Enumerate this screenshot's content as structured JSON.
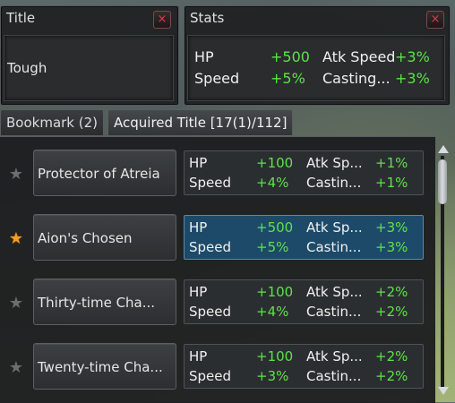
{
  "title_panel": {
    "header": "Title",
    "current": "Tough",
    "close": "×"
  },
  "stats_panel": {
    "header": "Stats",
    "close": "×",
    "lines": [
      {
        "a": "HP",
        "av": "+500",
        "b": "Atk Speed",
        "bv": "+3%"
      },
      {
        "a": "Speed",
        "av": "+5%",
        "b": "Casting...",
        "bv": "+3%"
      }
    ]
  },
  "tabs": [
    {
      "label": "Bookmark (2)"
    },
    {
      "label": "Acquired Title [17(1)/112]"
    }
  ],
  "titles": [
    {
      "name": "Protector of Atreia",
      "star": "★",
      "starred": false,
      "selected": false,
      "lines": [
        {
          "a": "HP",
          "av": "+100",
          "b": "Atk Sp...",
          "bv": "+1%"
        },
        {
          "a": "Speed",
          "av": "+4%",
          "b": "Castin...",
          "bv": "+1%"
        }
      ]
    },
    {
      "name": "Aion's Chosen",
      "star": "★",
      "starred": true,
      "selected": true,
      "lines": [
        {
          "a": "HP",
          "av": "+500",
          "b": "Atk Sp...",
          "bv": "+3%"
        },
        {
          "a": "Speed",
          "av": "+5%",
          "b": "Castin...",
          "bv": "+3%"
        }
      ]
    },
    {
      "name": "Thirty-time Cha...",
      "star": "★",
      "starred": false,
      "selected": false,
      "lines": [
        {
          "a": "HP",
          "av": "+100",
          "b": "Atk Sp...",
          "bv": "+2%"
        },
        {
          "a": "Speed",
          "av": "+4%",
          "b": "Castin...",
          "bv": "+2%"
        }
      ]
    },
    {
      "name": "Twenty-time Cha...",
      "star": "★",
      "starred": false,
      "selected": false,
      "lines": [
        {
          "a": "HP",
          "av": "+100",
          "b": "Atk Sp...",
          "bv": "+2%"
        },
        {
          "a": "Speed",
          "av": "+3%",
          "b": "Castin...",
          "bv": "+2%"
        }
      ]
    }
  ],
  "colors": {
    "bonus": "#5de24a",
    "star_on": "#f0a020",
    "close": "#d04050",
    "selected_bg": "#1d4a68"
  }
}
